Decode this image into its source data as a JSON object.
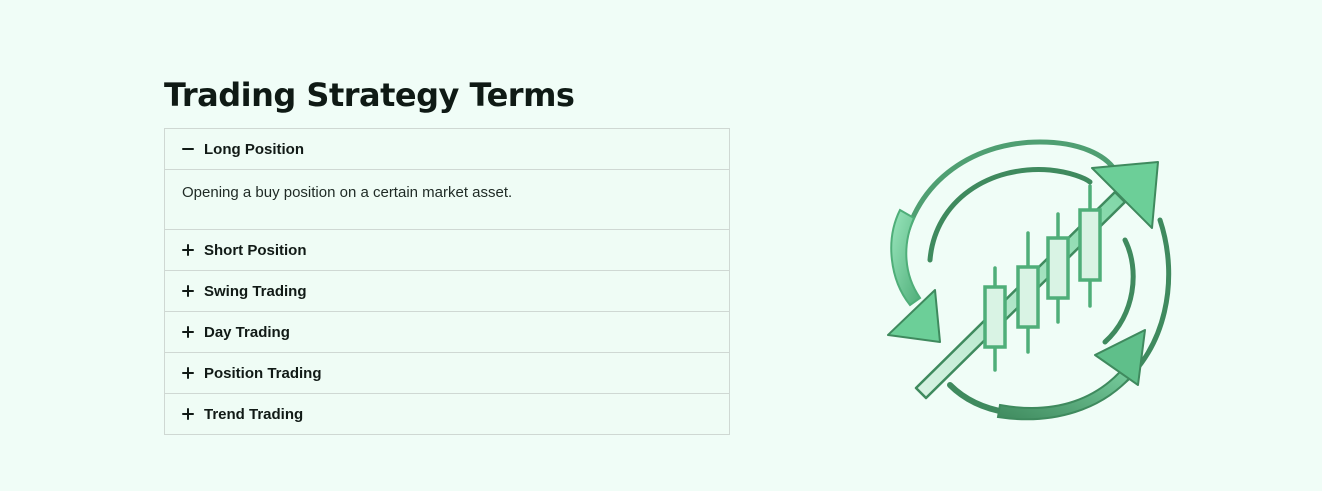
{
  "page": {
    "title": "Trading Strategy Terms"
  },
  "accordion": {
    "items": [
      {
        "title": "Long Position",
        "expanded": true,
        "toggle_icon": "minus-icon",
        "content": "Opening a buy position on a certain market asset."
      },
      {
        "title": "Short Position",
        "expanded": false,
        "toggle_icon": "plus-icon"
      },
      {
        "title": "Swing Trading",
        "expanded": false,
        "toggle_icon": "plus-icon"
      },
      {
        "title": "Day Trading",
        "expanded": false,
        "toggle_icon": "plus-icon"
      },
      {
        "title": "Position Trading",
        "expanded": false,
        "toggle_icon": "plus-icon"
      },
      {
        "title": "Trend Trading",
        "expanded": false,
        "toggle_icon": "plus-icon"
      }
    ]
  },
  "illustration": {
    "icon": "trading-growth-icon",
    "colors": {
      "light": "#8fe0b4",
      "mid": "#5fbf8a",
      "dark": "#3f8a5e",
      "fill": "#d9f3e4"
    }
  }
}
